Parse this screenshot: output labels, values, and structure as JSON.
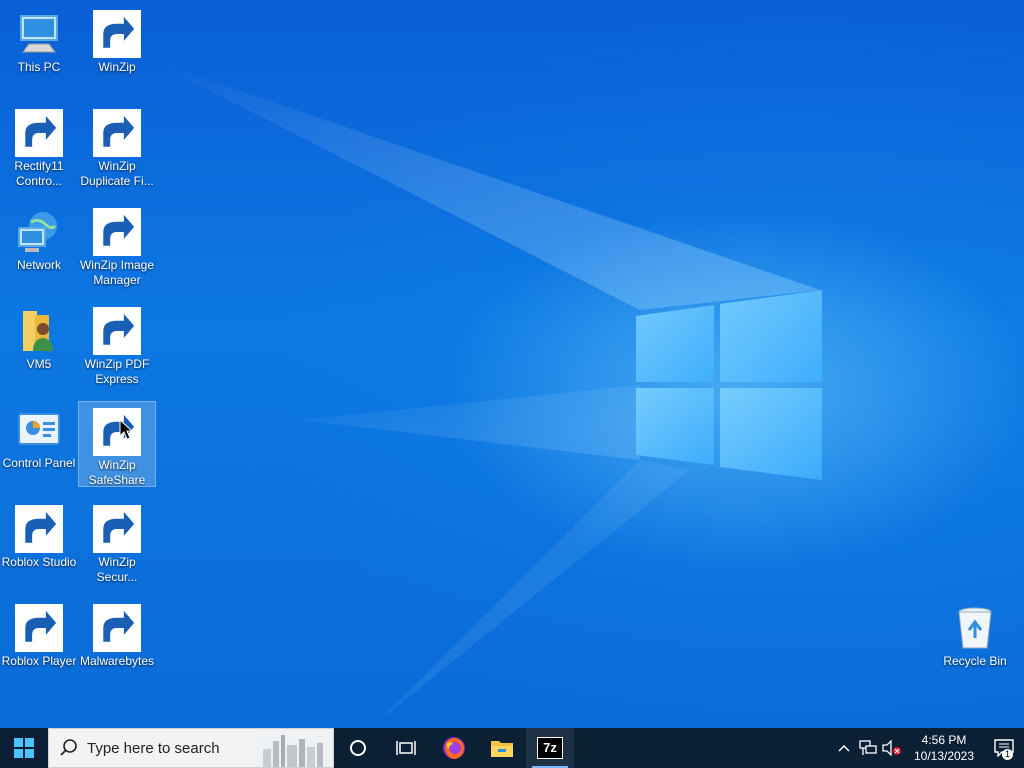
{
  "desktop": {
    "icons": [
      {
        "label": "This PC"
      },
      {
        "label": "WinZip"
      },
      {
        "label": "Rectify11 Contro..."
      },
      {
        "label": "WinZip Duplicate Fi..."
      },
      {
        "label": "Network"
      },
      {
        "label": "WinZip Image Manager"
      },
      {
        "label": "VM5"
      },
      {
        "label": "WinZip PDF Express"
      },
      {
        "label": "Control Panel"
      },
      {
        "label": "WinZip SafeShare"
      },
      {
        "label": "Roblox Studio"
      },
      {
        "label": "WinZip Secur..."
      },
      {
        "label": "Roblox Player"
      },
      {
        "label": "Malwarebytes"
      },
      {
        "label": "Recycle Bin"
      }
    ],
    "selected_icon": "WinZip SafeShare"
  },
  "taskbar": {
    "search_placeholder": "Type here to search",
    "pinned": [
      "cortana",
      "task-view",
      "firefox",
      "file-explorer",
      "7-zip"
    ],
    "sevenzip_label": "7z",
    "clock": {
      "time": "4:56 PM",
      "date": "10/13/2023"
    },
    "notification_count": "1"
  },
  "colors": {
    "taskbar": "#0b2035",
    "wallpaper_blue": "#0c78e2",
    "accent": "#7cb8ff"
  }
}
